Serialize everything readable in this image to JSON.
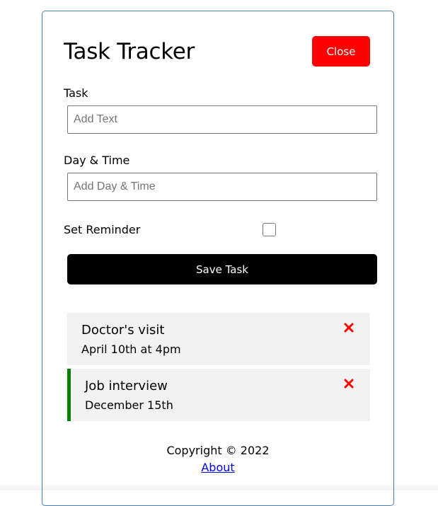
{
  "header": {
    "title": "Task Tracker",
    "close_label": "Close"
  },
  "form": {
    "task_label": "Task",
    "task_placeholder": "Add Text",
    "day_label": "Day & Time",
    "day_placeholder": "Add Day & Time",
    "reminder_label": "Set Reminder",
    "reminder_checked": false,
    "save_label": "Save Task"
  },
  "tasks": [
    {
      "text": "Doctor's visit",
      "day": "April 10th at 4pm",
      "reminder": false
    },
    {
      "text": "Job interview",
      "day": "December 15th",
      "reminder": true
    }
  ],
  "footer": {
    "copyright": "Copyright © 2022",
    "about_label": "About"
  },
  "colors": {
    "close_button": "#ff0000",
    "save_button": "#000000",
    "task_background": "#f2f2f2",
    "reminder_border": "#008000",
    "delete_icon": "#ff0000",
    "link": "#0000ee"
  },
  "icons": {
    "delete": "times-icon"
  }
}
